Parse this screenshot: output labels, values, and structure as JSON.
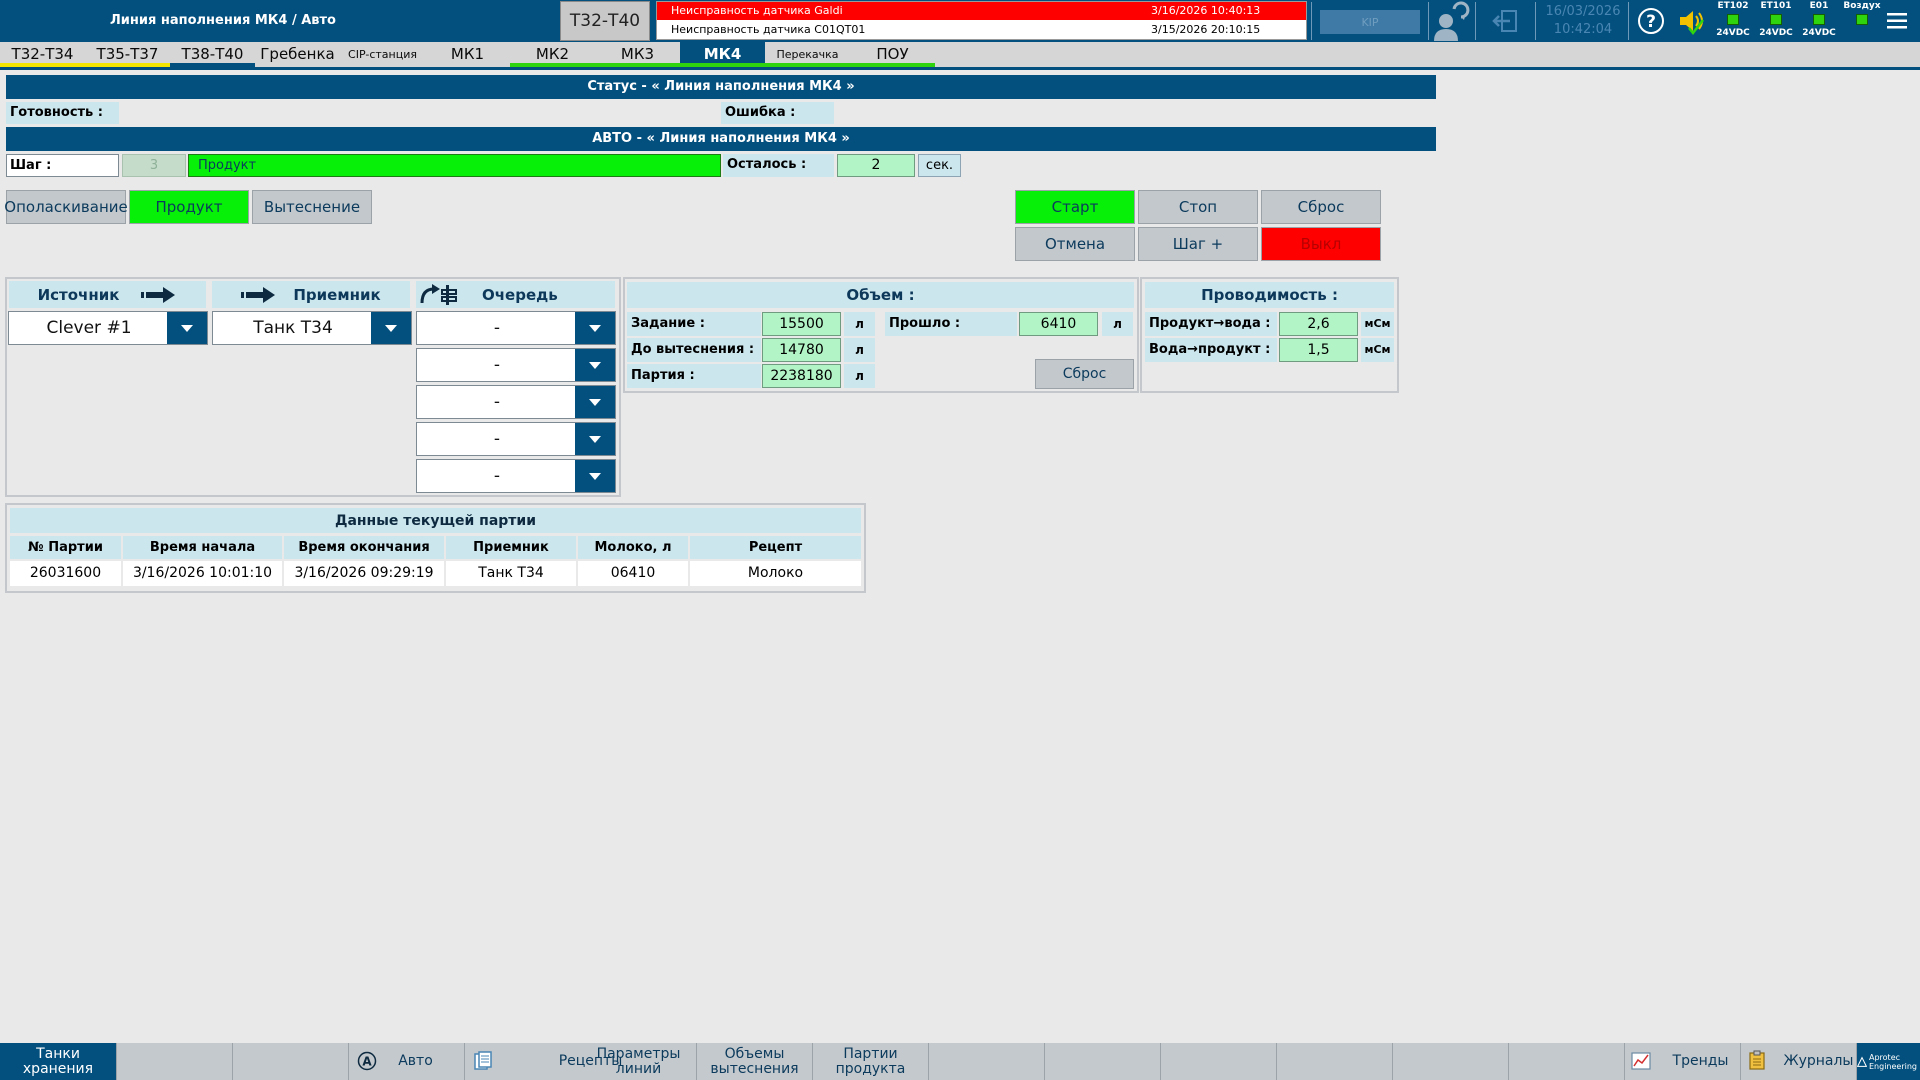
{
  "header": {
    "title": "Линия наполнения МК4 / Авто",
    "area_button": "Т32-Т40",
    "alarms": [
      {
        "text": "Неисправность датчика Galdi",
        "time": "3/16/2026 10:40:13",
        "color": "#ff0000"
      },
      {
        "text": "Неисправность датчика C01QT01",
        "time": "3/15/2026 20:10:15",
        "color": "#ffffff"
      }
    ],
    "kip_label": "KIP",
    "date": "16/03/2026",
    "time": "10:42:04",
    "io_modules": [
      {
        "name": "ET102",
        "voltage": "24VDC"
      },
      {
        "name": "ET101",
        "voltage": "24VDC"
      },
      {
        "name": "E01",
        "voltage": "24VDC"
      },
      {
        "name": "Воздух",
        "voltage": ""
      }
    ]
  },
  "tabs": [
    {
      "label": "Т32-Т34",
      "line_color": "#f4e600"
    },
    {
      "label": "Т35-Т37",
      "line_color": "#f4e600"
    },
    {
      "label": "Т38-Т40",
      "line_color": "#03507e"
    },
    {
      "label": "Гребенка",
      "line_color": ""
    },
    {
      "label": "CIP-станция",
      "line_color": ""
    },
    {
      "label": "МК1",
      "line_color": ""
    },
    {
      "label": "МК2",
      "line_color": "#2fd40f"
    },
    {
      "label": "МК3",
      "line_color": "#2fd40f"
    },
    {
      "label": "МК4",
      "line_color": "#2fd40f",
      "active": true
    },
    {
      "label": "Перекачка",
      "line_color": "#2fd40f"
    },
    {
      "label": "ПОУ",
      "line_color": "#2fd40f"
    }
  ],
  "status": {
    "title": "Статус - « Линия наполнения МК4 »",
    "ready_label": "Готовность :",
    "error_label": "Ошибка :",
    "auto_title": "АВТО - « Линия наполнения МК4 »",
    "step_label": "Шаг :",
    "step_number": "3",
    "step_name": "Продукт",
    "remaining_label": "Осталось :",
    "remaining_value": "2",
    "remaining_unit": "сек."
  },
  "modes": {
    "rinse": "Ополаскивание",
    "product": "Продукт",
    "displace": "Вытеснение"
  },
  "controls": {
    "start": "Старт",
    "stop": "Стоп",
    "reset": "Сброс",
    "cancel": "Отмена",
    "step_plus": "Шаг +",
    "off": "Выкл"
  },
  "route": {
    "source_header": "Источник",
    "receiver_header": "Приемник",
    "queue_header": "Очередь",
    "source_value": "Clever #1",
    "receiver_value": "Танк Т34",
    "queue": [
      "-",
      "-",
      "-",
      "-",
      "-"
    ]
  },
  "volume": {
    "header": "Объем :",
    "setpoint_label": "Задание :",
    "setpoint_value": "15500",
    "to_displace_label": "До вытеснения :",
    "to_displace_value": "14780",
    "batch_label": "Партия :",
    "batch_value": "2238180",
    "passed_label": "Прошло :",
    "passed_value": "6410",
    "unit": "л",
    "reset": "Сброс"
  },
  "conductivity": {
    "header": "Проводимость :",
    "product_water_label": "Продукт→вода :",
    "product_water_value": "2,6",
    "water_product_label": "Вода→продукт :",
    "water_product_value": "1,5",
    "unit": "мСм"
  },
  "batch_table": {
    "title": "Данные текущей партии",
    "columns": [
      "№ Партии",
      "Время начала",
      "Время окончания",
      "Приемник",
      "Молоко, л",
      "Рецепт"
    ],
    "rows": [
      [
        "26031600",
        "3/16/2026 10:01:10",
        "3/16/2026 09:29:19",
        "Танк Т34",
        "06410",
        "Молоко"
      ]
    ]
  },
  "bottom_nav": {
    "storage_tanks": "Танки хранения",
    "auto": "Авто",
    "recipes": "Рецепты",
    "line_params": "Параметры линий",
    "displace_volumes": "Объемы вытеснения",
    "product_batches": "Партии продукта",
    "trends": "Тренды",
    "journals": "Журналы",
    "logo_text": "Aprotec Engineering"
  },
  "colors": {
    "brand_blue": "#03507e",
    "active_green": "#07f007",
    "alarm_red": "#ff0000",
    "panel_header": "#cce6ee",
    "value_green": "#b2f4c5"
  }
}
